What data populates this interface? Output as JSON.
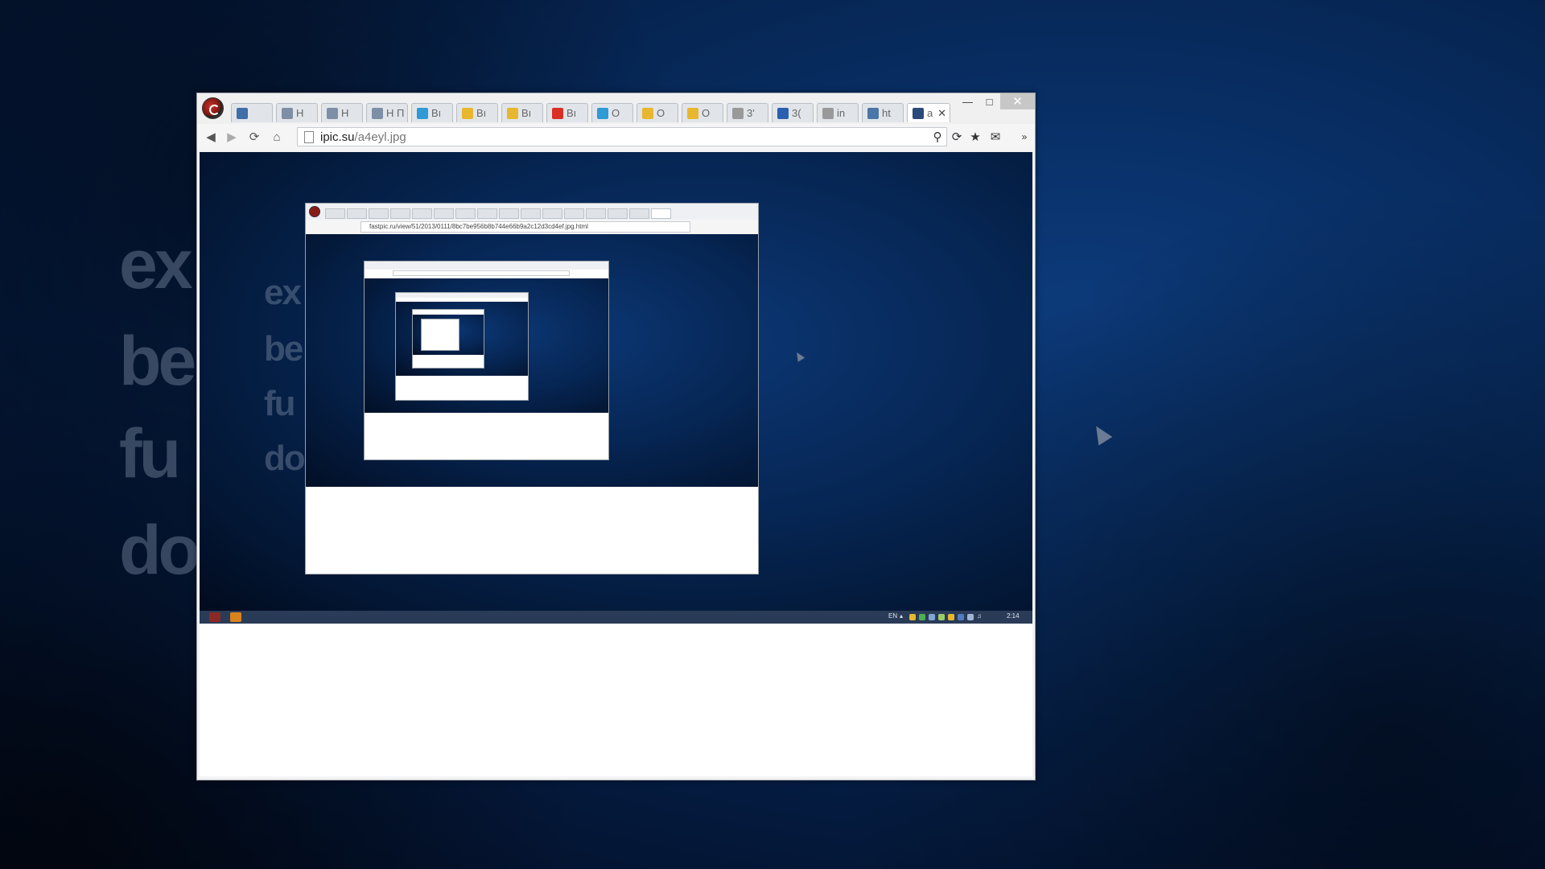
{
  "desktop": {
    "background_words": [
      "ex",
      "be",
      "fu",
      "do"
    ]
  },
  "browser": {
    "tabs": [
      {
        "label": "",
        "icon": "chat-icon",
        "color": "#3f6fa8"
      },
      {
        "label": "H",
        "icon": "h-icon",
        "color": "#7d8fa6"
      },
      {
        "label": "H",
        "icon": "h-icon",
        "color": "#7d8fa6"
      },
      {
        "label": "H П",
        "icon": "h-icon",
        "color": "#7d8fa6"
      },
      {
        "label": "Bı",
        "icon": "swirl-icon",
        "color": "#2e9ad6"
      },
      {
        "label": "Bı",
        "icon": "hand-icon",
        "color": "#e8b62f"
      },
      {
        "label": "Bı",
        "icon": "hand-icon",
        "color": "#e8b62f"
      },
      {
        "label": "Bı",
        "icon": "gmail-icon",
        "color": "#d93025"
      },
      {
        "label": "O",
        "icon": "swirl-icon",
        "color": "#2e9ad6"
      },
      {
        "label": "O",
        "icon": "hand-icon",
        "color": "#e8b62f"
      },
      {
        "label": "O",
        "icon": "hand-icon",
        "color": "#e8b62f"
      },
      {
        "label": "3'",
        "icon": "page-icon",
        "color": "#999999"
      },
      {
        "label": "3(",
        "icon": "grid-icon",
        "color": "#2a5fb0"
      },
      {
        "label": "in",
        "icon": "page-icon",
        "color": "#999999"
      },
      {
        "label": "ht",
        "icon": "vk-icon",
        "color": "#4a76a8"
      },
      {
        "label": "a",
        "icon": "shield-icon",
        "color": "#2a4a7a"
      }
    ],
    "url": {
      "host": "ipic.su",
      "path": "/a4eyl.jpg"
    },
    "nested_url": "fastpic.ru/view/51/2013/0111/8bc7be956b8b744e66b9a2c12d3cd4ef.jpg.html",
    "taskbar": {
      "lang": "EN",
      "time": "2:14"
    }
  },
  "colors": {
    "desktop_blue": "#0c3a7a",
    "window_chrome": "#f0f0f0",
    "close_button": "#c7c7c7"
  }
}
